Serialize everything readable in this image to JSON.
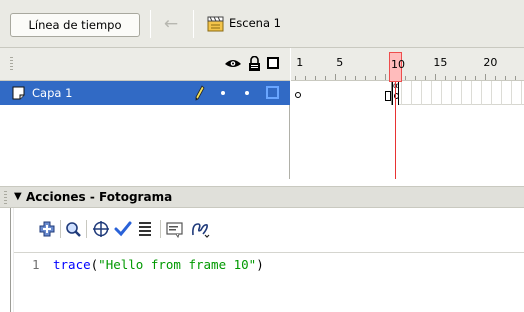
{
  "toolbar": {
    "timeline_label": "Línea de tiempo",
    "scene_label": "Escena 1",
    "icons": [
      "back-arrow-icon",
      "scene-icon"
    ]
  },
  "timeline": {
    "header_icons": [
      "eye-icon",
      "lock-icon",
      "outline-icon"
    ],
    "ruler_numbers": [
      "1",
      "5",
      "10",
      "15",
      "20"
    ],
    "current_frame": "10",
    "layers": [
      {
        "name": "Capa 1",
        "selected": true,
        "icons": [
          "layer-icon",
          "pencil-icon"
        ]
      }
    ],
    "keyframe_action_marker": "α",
    "colors": {
      "selected_layer": "#316ac5",
      "playhead": "#e83232",
      "playhead_fill": "#ffbcbc"
    }
  },
  "actions": {
    "panel_title": "Acciones - Fotograma",
    "toolbar_icons": [
      "add-icon",
      "find-icon",
      "target-icon",
      "check-syntax-icon",
      "auto-format-icon",
      "code-hint-icon",
      "debug-options-icon"
    ],
    "code_lines": [
      {
        "line_number": "1",
        "keyword": "trace",
        "open": "(",
        "string": "\"Hello from frame 10\"",
        "close": ")"
      }
    ]
  }
}
